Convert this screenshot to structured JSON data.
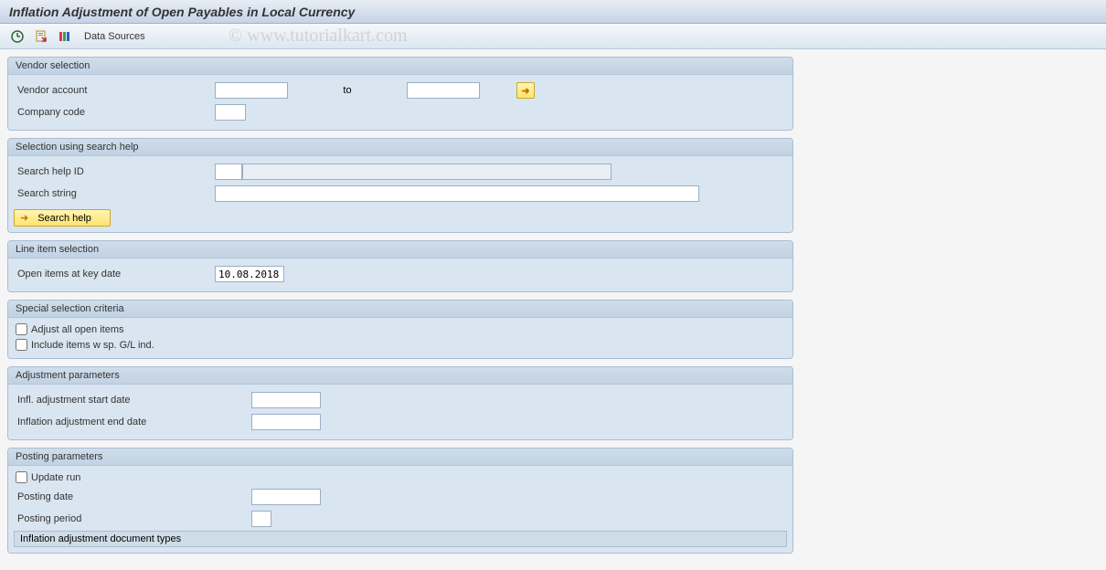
{
  "title": "Inflation Adjustment of Open Payables in Local Currency",
  "watermark": "© www.tutorialkart.com",
  "toolbar": {
    "data_sources_label": "Data Sources"
  },
  "groups": {
    "vendor_selection": {
      "title": "Vendor selection",
      "vendor_account_label": "Vendor account",
      "vendor_account_from": "",
      "to_label": "to",
      "vendor_account_to": "",
      "company_code_label": "Company code",
      "company_code_value": ""
    },
    "search_help": {
      "title": "Selection using search help",
      "search_help_id_label": "Search help ID",
      "search_help_id_value": "",
      "search_help_id_desc": "",
      "search_string_label": "Search string",
      "search_string_value": "",
      "button_label": "Search help"
    },
    "line_item": {
      "title": "Line item selection",
      "open_items_key_date_label": "Open items at key date",
      "open_items_key_date_value": "10.08.2018"
    },
    "special_criteria": {
      "title": "Special selection criteria",
      "adjust_all_label": "Adjust all open items",
      "include_sp_gl_label": "Include items w sp. G/L ind."
    },
    "adjustment_params": {
      "title": "Adjustment parameters",
      "start_date_label": "Infl. adjustment start date",
      "start_date_value": "",
      "end_date_label": "Inflation adjustment end date",
      "end_date_value": ""
    },
    "posting_params": {
      "title": "Posting parameters",
      "update_run_label": "Update run",
      "posting_date_label": "Posting date",
      "posting_date_value": "",
      "posting_period_label": "Posting period",
      "posting_period_value": "",
      "doc_types_label": "Inflation adjustment document types"
    }
  }
}
